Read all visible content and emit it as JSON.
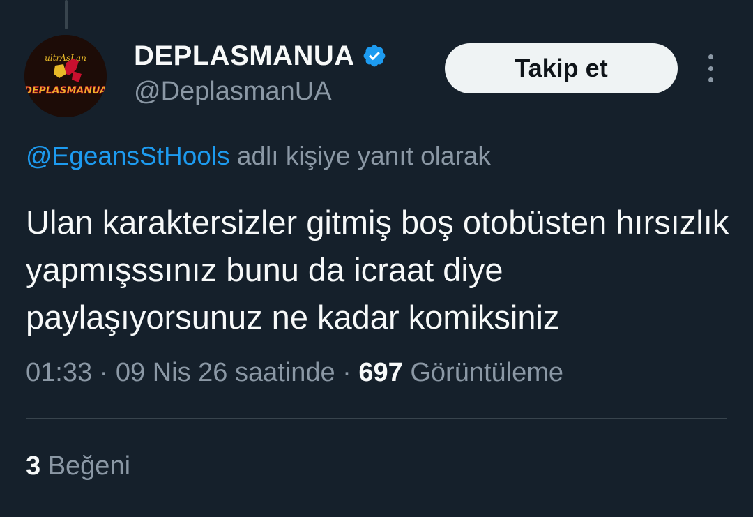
{
  "author": {
    "name": "DEPLASMANUA",
    "handle": "@DeplasmanUA",
    "verified": true,
    "avatar_text": "DEPLASMANUA",
    "avatar_subtext": "ultrAsLan"
  },
  "follow_button": {
    "label": "Takip et"
  },
  "reply_context": {
    "mention": "@EgeansStHools",
    "suffix": " adlı kişiye yanıt olarak"
  },
  "tweet": {
    "text": "Ulan karaktersizler gitmiş boş otobüsten hırsızlık yapmışssınız bunu da icraat diye paylaşıyorsunuz ne kadar komiksiniz",
    "timestamp": "01:33 · 09 Nis 26 saatinde",
    "separator": " · ",
    "views_count": "697",
    "views_label": " Görüntüleme"
  },
  "engagement": {
    "likes_count": "3",
    "likes_label": " Beğeni"
  },
  "colors": {
    "background": "#15202b",
    "accent": "#1d9bf0",
    "secondary_text": "#8b98a5",
    "primary_text": "#f7f9f9"
  }
}
